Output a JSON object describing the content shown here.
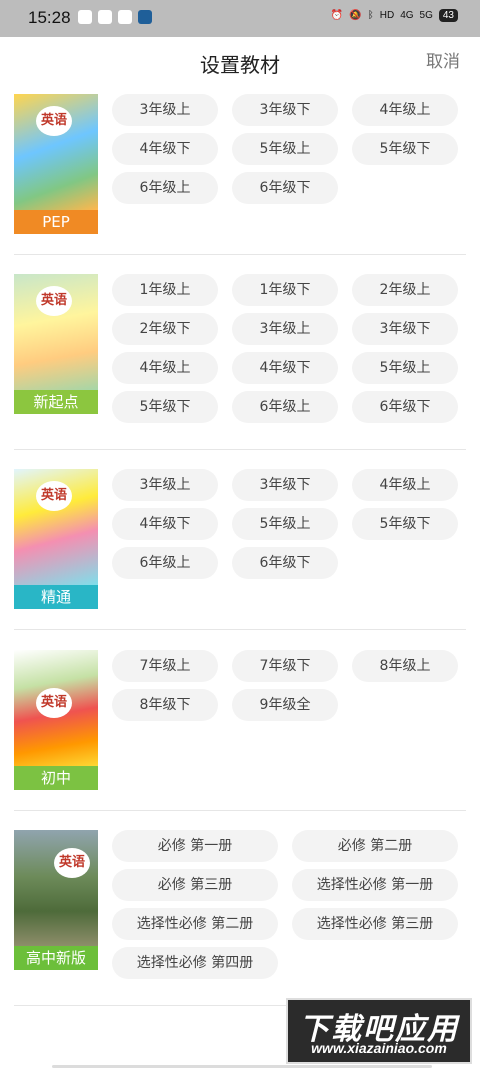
{
  "status_bar": {
    "time": "15:28",
    "network_labels": [
      "HD",
      "4G",
      "5G"
    ],
    "battery": "43"
  },
  "header": {
    "title": "设置教材",
    "cancel": "取消"
  },
  "sections": [
    {
      "cover_label": "PEP",
      "cover_title": "英语",
      "cover_color": "#f08a24",
      "grades": [
        "3年级上",
        "3年级下",
        "4年级上",
        "4年级下",
        "5年级上",
        "5年级下",
        "6年级上",
        "6年级下"
      ]
    },
    {
      "cover_label": "新起点",
      "cover_title": "英语",
      "cover_color": "#8cc63f",
      "grades": [
        "1年级上",
        "1年级下",
        "2年级上",
        "2年级下",
        "3年级上",
        "3年级下",
        "4年级上",
        "4年级下",
        "5年级上",
        "5年级下",
        "6年级上",
        "6年级下"
      ]
    },
    {
      "cover_label": "精通",
      "cover_title": "英语",
      "cover_color": "#29b6c6",
      "grades": [
        "3年级上",
        "3年级下",
        "4年级上",
        "4年级下",
        "5年级上",
        "5年级下",
        "6年级上",
        "6年级下"
      ]
    },
    {
      "cover_label": "初中",
      "cover_title": "英语",
      "cover_color": "#7cc242",
      "grades": [
        "7年级上",
        "7年级下",
        "8年级上",
        "8年级下",
        "9年级全"
      ]
    },
    {
      "cover_label": "高中新版",
      "cover_title": "英语",
      "cover_color": "#6cbf3a",
      "grades": [
        "必修 第一册",
        "必修 第二册",
        "必修 第三册",
        "选择性必修 第一册",
        "选择性必修 第二册",
        "选择性必修 第三册",
        "选择性必修 第四册"
      ]
    }
  ],
  "watermark": {
    "main": "下载吧应用",
    "sub": "www.xiazainiao.com"
  }
}
